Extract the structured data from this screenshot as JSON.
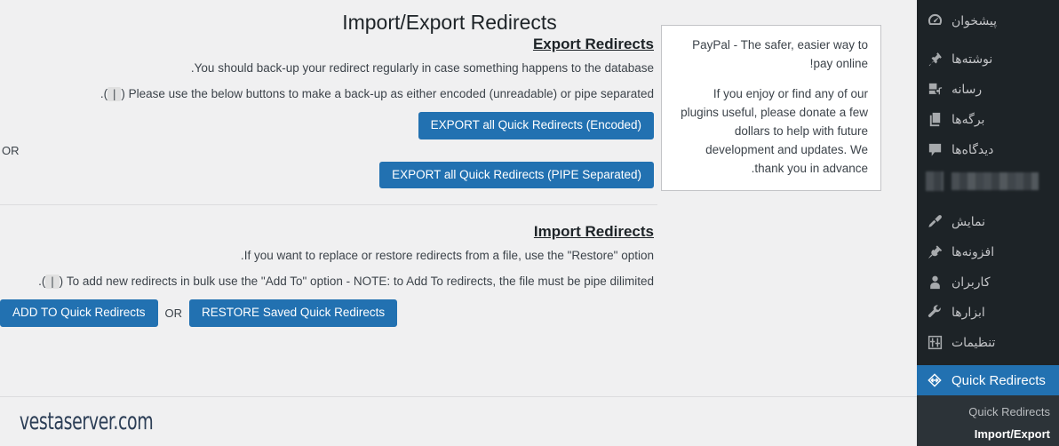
{
  "page": {
    "title": "Import/Export Redirects",
    "footer_brand": "vestaserver.com"
  },
  "paypal_box": {
    "headline": "PayPal - The safer, easier way to pay online!",
    "body": "If you enjoy or find any of our plugins useful, please donate a few dollars to help with future development and updates. We thank you in advance."
  },
  "export_section": {
    "heading": "Export Redirects",
    "desc1": "You should back-up your redirect regularly in case something happens to the database.",
    "desc2_before": "Please use the below buttons to make a back-up as either encoded (unreadable) or pipe separated (",
    "desc2_code": "|",
    "desc2_after": ").",
    "btn_encoded": "EXPORT all Quick Redirects (Encoded)",
    "or": "OR",
    "btn_pipe": "EXPORT all Quick Redirects (PIPE Separated)"
  },
  "import_section": {
    "heading": "Import Redirects",
    "desc1": "If you want to replace or restore redirects from a file, use the \"Restore\" option.",
    "desc2_before": "To add new redirects in bulk use the \"Add To\" option - NOTE: to Add To redirects, the file must be pipe dilimited (",
    "desc2_code": "|",
    "desc2_after": ").",
    "btn_add_to": "ADD TO Quick Redirects",
    "or": "OR",
    "btn_restore": "RESTORE Saved Quick Redirects"
  },
  "sidebar": {
    "items": [
      {
        "label": "پیشخوان",
        "icon": "dashboard-icon"
      },
      {
        "label": "نوشته‌ها",
        "icon": "pin-icon"
      },
      {
        "label": "رسانه",
        "icon": "media-icon"
      },
      {
        "label": "برگه‌ها",
        "icon": "pages-icon"
      },
      {
        "label": "دیدگاه‌ها",
        "icon": "comments-icon"
      },
      {
        "label": "",
        "icon": "redacted-icon",
        "redacted": true
      },
      {
        "label": "نمایش",
        "icon": "appearance-brush-icon"
      },
      {
        "label": "افزونه‌ها",
        "icon": "plugins-plug-icon"
      },
      {
        "label": "کاربران",
        "icon": "users-icon"
      },
      {
        "label": "ابزارها",
        "icon": "tools-wrench-icon"
      },
      {
        "label": "تنظیمات",
        "icon": "settings-sliders-icon"
      }
    ],
    "current": {
      "label": "Quick Redirects",
      "icon": "redirect-arrows-icon"
    },
    "submenu": [
      {
        "label": "Quick Redirects",
        "active": false
      },
      {
        "label": "Import/Export",
        "active": true
      }
    ]
  },
  "colors": {
    "accent_blue": "#2271b1",
    "sidebar_bg": "#1d2327",
    "submenu_bg": "#2c3338",
    "page_bg": "#f0f0f1",
    "brand_navy": "#2c3e56"
  }
}
